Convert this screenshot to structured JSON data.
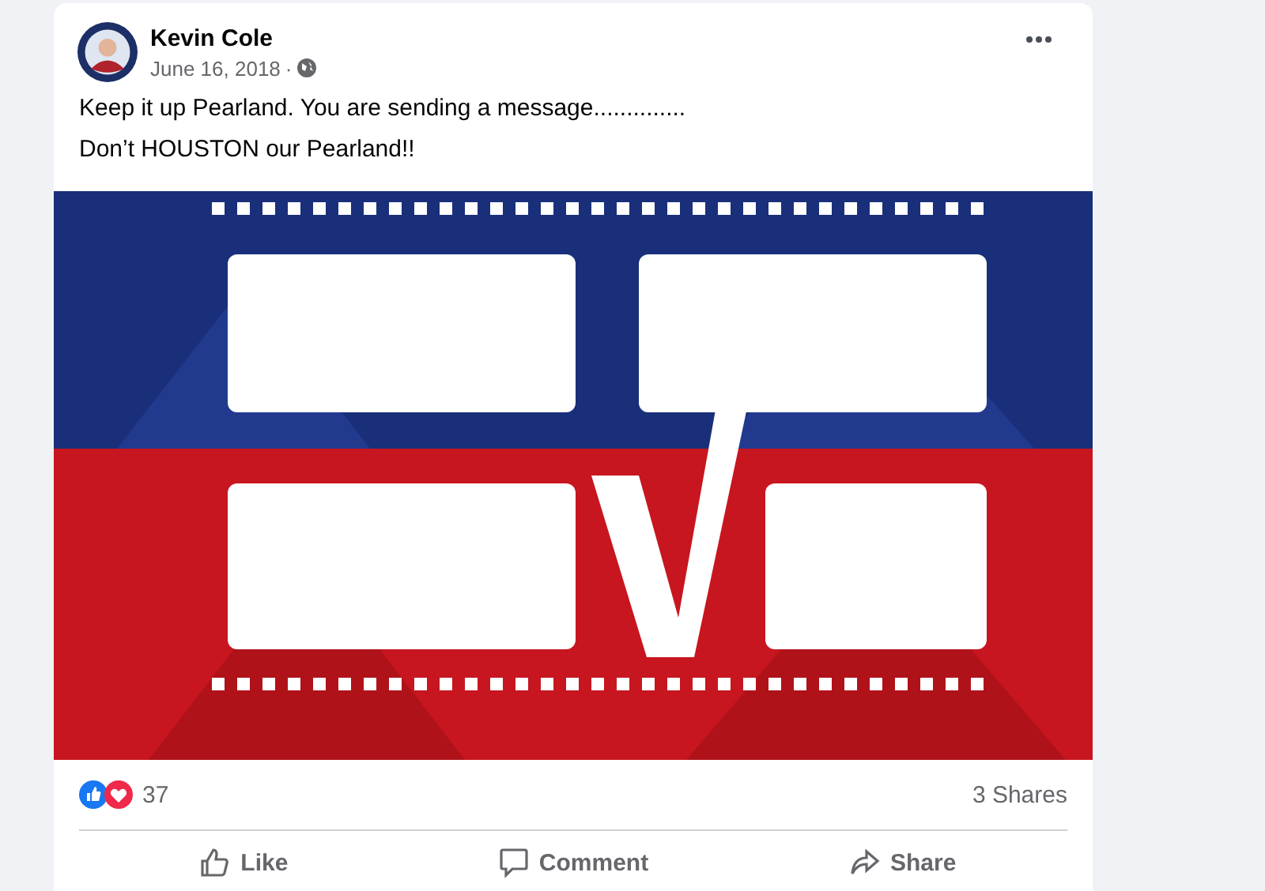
{
  "post": {
    "author": "Kevin Cole",
    "date": "June 16, 2018",
    "separator": "·",
    "text": [
      "Keep it up Pearland. You are sending a message..............",
      "Don’t HOUSTON our Pearland!!"
    ],
    "media": {
      "kind": "picture"
    },
    "reaction_count": "37",
    "shares": "3 Shares",
    "actions": [
      {
        "kind": "like",
        "label": "Like"
      },
      {
        "kind": "comment",
        "label": "Comment"
      },
      {
        "kind": "share",
        "label": "Share"
      }
    ]
  }
}
